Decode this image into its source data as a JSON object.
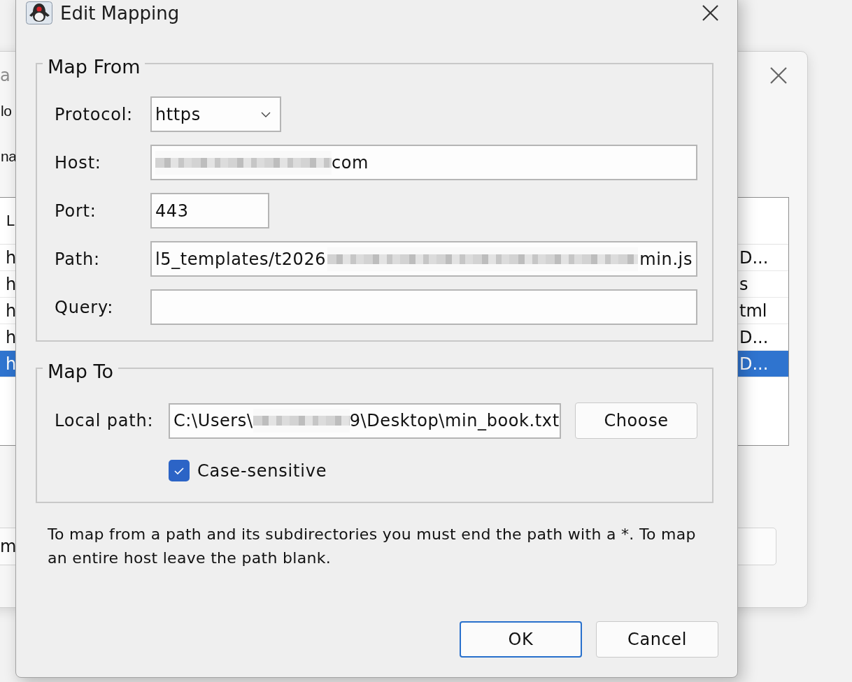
{
  "background_window": {
    "title": "a",
    "labels": [
      "lo",
      "na"
    ],
    "table": {
      "header": "L",
      "rows": [
        {
          "cells": [
            "h",
            "D..."
          ],
          "selected": false
        },
        {
          "cells": [
            "h",
            "s"
          ],
          "selected": false
        },
        {
          "cells": [
            "h",
            "tml"
          ],
          "selected": false
        },
        {
          "cells": [
            "h",
            "D..."
          ],
          "selected": false
        },
        {
          "cells": [
            "h",
            "D..."
          ],
          "selected": true
        }
      ]
    },
    "field_value": "m"
  },
  "dialog": {
    "title": "Edit Mapping"
  },
  "map_from": {
    "title": "Map From",
    "fields": [
      {
        "kind": "dropdown",
        "label": "Protocol:",
        "value": "https"
      },
      {
        "kind": "text",
        "label": "Host:",
        "segments": [
          {
            "kind": "redacted"
          },
          {
            "kind": "text",
            "text": "com"
          }
        ]
      },
      {
        "kind": "number",
        "label": "Port:",
        "segments": [
          {
            "kind": "text",
            "text": "443"
          }
        ]
      },
      {
        "kind": "text",
        "label": "Path:",
        "segments": [
          {
            "kind": "text",
            "text": "l5_templates/t2026"
          },
          {
            "kind": "redacted"
          },
          {
            "kind": "text",
            "text": "min.js"
          }
        ]
      },
      {
        "kind": "text",
        "label": "Query:"
      }
    ]
  },
  "map_to": {
    "title": "Map To",
    "local_path": {
      "label": "Local path:",
      "segments": [
        {
          "kind": "text",
          "text": "C:\\Users\\"
        },
        {
          "kind": "redacted"
        },
        {
          "kind": "text",
          "text": "9\\Desktop\\min_book.txt"
        }
      ]
    },
    "choose_button": "Choose",
    "case_sensitive": {
      "label": "Case-sensitive",
      "checked": true
    }
  },
  "help_text": "To map from a path and its subdirectories you must end the path with a *. To map an entire host leave the path blank.",
  "buttons": [
    {
      "label": "OK",
      "default": true
    },
    {
      "label": "Cancel",
      "default": false
    }
  ]
}
